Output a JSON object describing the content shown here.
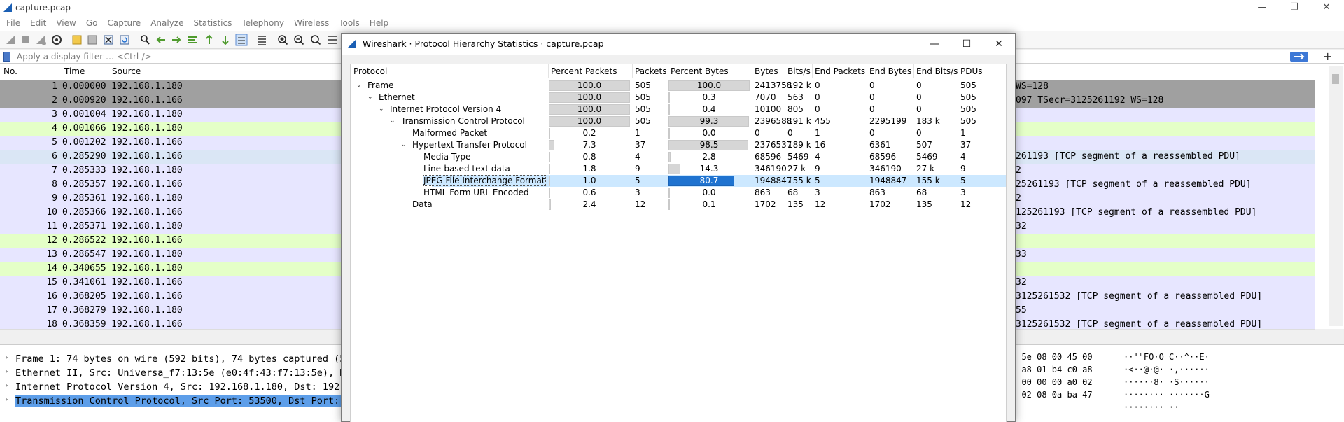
{
  "window": {
    "title": "capture.pcap"
  },
  "menu": [
    "File",
    "Edit",
    "View",
    "Go",
    "Capture",
    "Analyze",
    "Statistics",
    "Telephony",
    "Wireless",
    "Tools",
    "Help"
  ],
  "filter": {
    "placeholder": "Apply a display filter … <Ctrl-/>"
  },
  "packet_list": {
    "columns": [
      "No.",
      "Time",
      "Source"
    ],
    "rows": [
      {
        "no": "1",
        "time": "0.000000",
        "src": "192.168.1.180",
        "info": "WS=128",
        "bg": "#a0a0a0"
      },
      {
        "no": "2",
        "time": "0.000920",
        "src": "192.168.1.166",
        "info": "097 TSecr=3125261192 WS=128",
        "bg": "#a0a0a0"
      },
      {
        "no": "3",
        "time": "0.001004",
        "src": "192.168.1.180",
        "info": "",
        "bg": "#e7e6ff"
      },
      {
        "no": "4",
        "time": "0.001066",
        "src": "192.168.1.180",
        "info": "",
        "bg": "#e4ffc7"
      },
      {
        "no": "5",
        "time": "0.001202",
        "src": "192.168.1.166",
        "info": "",
        "bg": "#e7e6ff"
      },
      {
        "no": "6",
        "time": "0.285290",
        "src": "192.168.1.166",
        "info": "261193 [TCP segment of a reassembled PDU]",
        "bg": "#dae6f5"
      },
      {
        "no": "7",
        "time": "0.285333",
        "src": "192.168.1.180",
        "info": "2",
        "bg": "#e7e6ff"
      },
      {
        "no": "8",
        "time": "0.285357",
        "src": "192.168.1.166",
        "info": "25261193 [TCP segment of a reassembled PDU]",
        "bg": "#e7e6ff"
      },
      {
        "no": "9",
        "time": "0.285361",
        "src": "192.168.1.180",
        "info": "2",
        "bg": "#e7e6ff"
      },
      {
        "no": "10",
        "time": "0.285366",
        "src": "192.168.1.166",
        "info": "125261193 [TCP segment of a reassembled PDU]",
        "bg": "#e7e6ff"
      },
      {
        "no": "11",
        "time": "0.285371",
        "src": "192.168.1.180",
        "info": "32",
        "bg": "#e7e6ff"
      },
      {
        "no": "12",
        "time": "0.286522",
        "src": "192.168.1.166",
        "info": "",
        "bg": "#e4ffc7"
      },
      {
        "no": "13",
        "time": "0.286547",
        "src": "192.168.1.180",
        "info": "33",
        "bg": "#e7e6ff"
      },
      {
        "no": "14",
        "time": "0.340655",
        "src": "192.168.1.180",
        "info": "",
        "bg": "#e4ffc7"
      },
      {
        "no": "15",
        "time": "0.341061",
        "src": "192.168.1.166",
        "info": "32",
        "bg": "#e7e6ff"
      },
      {
        "no": "16",
        "time": "0.368205",
        "src": "192.168.1.166",
        "info": "3125261532 [TCP segment of a reassembled PDU]",
        "bg": "#e7e6ff"
      },
      {
        "no": "17",
        "time": "0.368279",
        "src": "192.168.1.180",
        "info": "55",
        "bg": "#e7e6ff"
      },
      {
        "no": "18",
        "time": "0.368359",
        "src": "192.168.1.166",
        "info": "3125261532 [TCP segment of a reassembled PDU]",
        "bg": "#e7e6ff"
      }
    ]
  },
  "details": [
    {
      "text": "Frame 1: 74 bytes on wire (592 bits), 74 bytes captured (5",
      "selected": false
    },
    {
      "text": "Ethernet II, Src: Universa_f7:13:5e (e0:4f:43:f7:13:5e), D",
      "selected": false
    },
    {
      "text": "Internet Protocol Version 4, Src: 192.168.1.180, Dst: 192.",
      "selected": false
    },
    {
      "text": "Transmission Control Protocol, Src Port: 53500, Dst Port:",
      "selected": true
    }
  ],
  "bytes": {
    "hex": [
      "3 5e 08 00 45 00",
      "0 a8 01 b4 c0 a8",
      "0 00 00 00 a0 02",
      "4 02 08 0a ba 47",
      ""
    ],
    "ascii": [
      "··'\"FO·O C··^··E·",
      "·<··@·@· ·,······",
      "······8· ·S······",
      "········ ·······G",
      "········ ··"
    ]
  },
  "dialog": {
    "title": "Wireshark · Protocol Hierarchy Statistics · capture.pcap",
    "columns": [
      "Protocol",
      "Percent Packets",
      "Packets",
      "Percent Bytes",
      "Bytes",
      "Bits/s",
      "End Packets",
      "End Bytes",
      "End Bits/s",
      "PDUs"
    ],
    "rows": [
      {
        "indent": 0,
        "exp": "˅",
        "proto": "Frame",
        "pp": "100.0",
        "pp_frac": 1.0,
        "pk": "505",
        "pb": "100.0",
        "pb_frac": 1.0,
        "by": "2413758",
        "bps": "192 k",
        "ep": "0",
        "eb": "0",
        "ebps": "0",
        "pdu": "505",
        "sel": false
      },
      {
        "indent": 1,
        "exp": "˅",
        "proto": "Ethernet",
        "pp": "100.0",
        "pp_frac": 1.0,
        "pk": "505",
        "pb": "0.3",
        "pb_frac": 0.003,
        "by": "7070",
        "bps": "563",
        "ep": "0",
        "eb": "0",
        "ebps": "0",
        "pdu": "505",
        "sel": false
      },
      {
        "indent": 2,
        "exp": "˅",
        "proto": "Internet Protocol Version 4",
        "pp": "100.0",
        "pp_frac": 1.0,
        "pk": "505",
        "pb": "0.4",
        "pb_frac": 0.004,
        "by": "10100",
        "bps": "805",
        "ep": "0",
        "eb": "0",
        "ebps": "0",
        "pdu": "505",
        "sel": false
      },
      {
        "indent": 3,
        "exp": "˅",
        "proto": "Transmission Control Protocol",
        "pp": "100.0",
        "pp_frac": 1.0,
        "pk": "505",
        "pb": "99.3",
        "pb_frac": 0.993,
        "by": "2396588",
        "bps": "191 k",
        "ep": "455",
        "eb": "2295199",
        "ebps": "183 k",
        "pdu": "505",
        "sel": false
      },
      {
        "indent": 4,
        "exp": "",
        "proto": "Malformed Packet",
        "pp": "0.2",
        "pp_frac": 0.002,
        "pk": "1",
        "pb": "0.0",
        "pb_frac": 0.0,
        "by": "0",
        "bps": "0",
        "ep": "1",
        "eb": "0",
        "ebps": "0",
        "pdu": "1",
        "sel": false
      },
      {
        "indent": 4,
        "exp": "˅",
        "proto": "Hypertext Transfer Protocol",
        "pp": "7.3",
        "pp_frac": 0.073,
        "pk": "37",
        "pb": "98.5",
        "pb_frac": 0.985,
        "by": "2376537",
        "bps": "189 k",
        "ep": "16",
        "eb": "6361",
        "ebps": "507",
        "pdu": "37",
        "sel": false
      },
      {
        "indent": 5,
        "exp": "",
        "proto": "Media Type",
        "pp": "0.8",
        "pp_frac": 0.008,
        "pk": "4",
        "pb": "2.8",
        "pb_frac": 0.028,
        "by": "68596",
        "bps": "5469",
        "ep": "4",
        "eb": "68596",
        "ebps": "5469",
        "pdu": "4",
        "sel": false
      },
      {
        "indent": 5,
        "exp": "",
        "proto": "Line-based text data",
        "pp": "1.8",
        "pp_frac": 0.018,
        "pk": "9",
        "pb": "14.3",
        "pb_frac": 0.143,
        "by": "346190",
        "bps": "27 k",
        "ep": "9",
        "eb": "346190",
        "ebps": "27 k",
        "pdu": "9",
        "sel": false
      },
      {
        "indent": 5,
        "exp": "",
        "proto": "JPEG File Interchange Format",
        "pp": "1.0",
        "pp_frac": 0.01,
        "pk": "5",
        "pb": "80.7",
        "pb_frac": 0.807,
        "by": "1948847",
        "bps": "155 k",
        "ep": "5",
        "eb": "1948847",
        "ebps": "155 k",
        "pdu": "5",
        "sel": true
      },
      {
        "indent": 5,
        "exp": "",
        "proto": "HTML Form URL Encoded",
        "pp": "0.6",
        "pp_frac": 0.006,
        "pk": "3",
        "pb": "0.0",
        "pb_frac": 0.0,
        "by": "863",
        "bps": "68",
        "ep": "3",
        "eb": "863",
        "ebps": "68",
        "pdu": "3",
        "sel": false
      },
      {
        "indent": 4,
        "exp": "",
        "proto": "Data",
        "pp": "2.4",
        "pp_frac": 0.024,
        "pk": "12",
        "pb": "0.1",
        "pb_frac": 0.001,
        "by": "1702",
        "bps": "135",
        "ep": "12",
        "eb": "1702",
        "ebps": "135",
        "pdu": "12",
        "sel": false
      }
    ]
  }
}
